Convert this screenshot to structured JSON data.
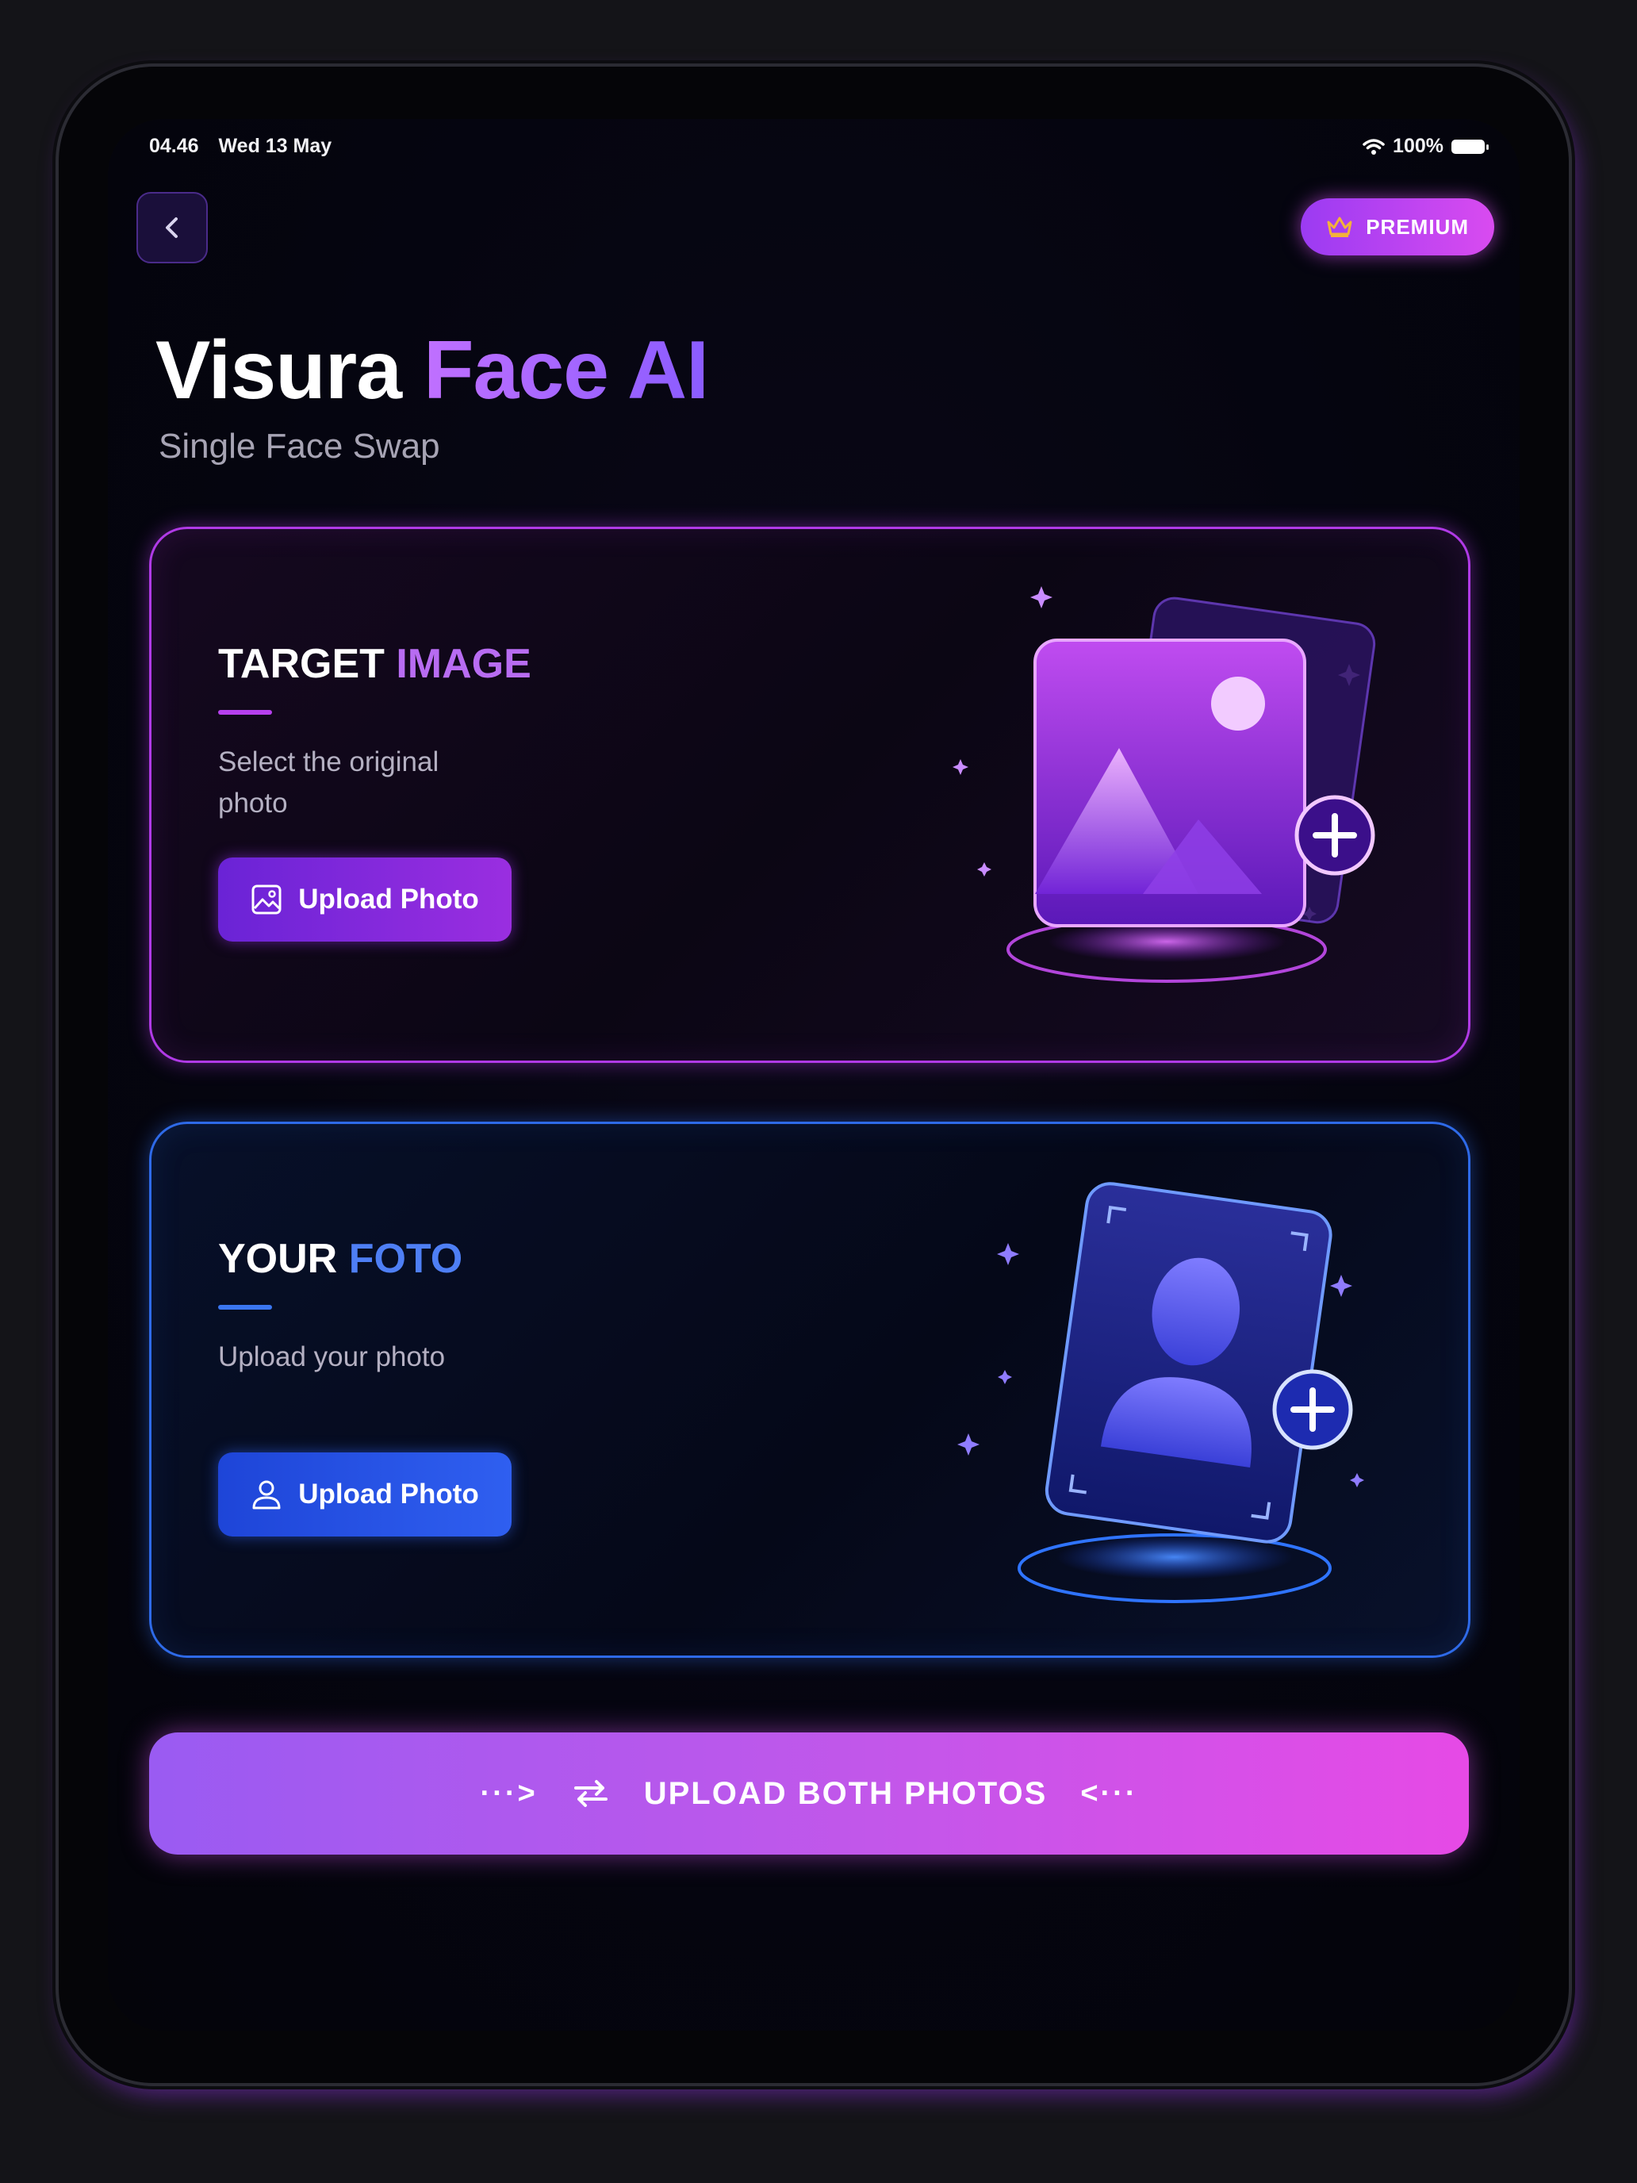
{
  "status": {
    "time": "04.46",
    "date": "Wed 13 May",
    "battery": "100%"
  },
  "header": {
    "premium_label": "PREMIUM"
  },
  "title": {
    "part1": "Visura",
    "part2": "Face AI",
    "subtitle": "Single Face Swap"
  },
  "target_card": {
    "title_part1": "TARGET",
    "title_part2": "IMAGE",
    "description": "Select the original photo",
    "button_label": "Upload Photo"
  },
  "your_card": {
    "title_part1": "YOUR",
    "title_part2": "FOTO",
    "description": "Upload your photo",
    "button_label": "Upload Photo"
  },
  "cta": {
    "left_arrow": "···>",
    "label": "UPLOAD BOTH PHOTOS",
    "right_arrow": "<···"
  },
  "colors": {
    "purple": "#b03ae6",
    "blue": "#2e6ae8",
    "pink": "#e64ae6",
    "gold": "#f3b23a"
  },
  "icons": [
    "back-chevron-icon",
    "crown-icon",
    "image-icon",
    "user-icon",
    "swap-icon",
    "wifi-icon",
    "battery-icon"
  ]
}
